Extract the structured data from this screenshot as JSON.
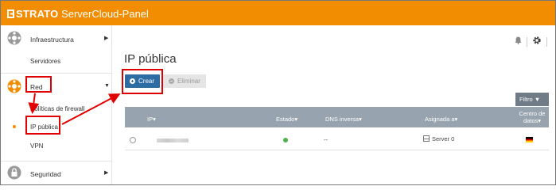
{
  "header": {
    "brand": "STRATO",
    "product": "ServerCloud-Panel"
  },
  "sidebar": {
    "sections": [
      {
        "label": "Infraestructura",
        "icon": "network-icon",
        "items": [
          "Servidores"
        ]
      },
      {
        "label": "Red",
        "icon": "network-red-icon",
        "items": [
          "Políticas de firewall",
          "IP pública",
          "VPN"
        ],
        "active_item": "IP pública"
      },
      {
        "label": "Seguridad",
        "icon": "lock-icon",
        "items": []
      }
    ]
  },
  "main": {
    "title": "IP pública",
    "buttons": {
      "create": "Crear",
      "delete": "Eliminar",
      "filter": "Filtro"
    },
    "table": {
      "columns": [
        "IP",
        "Estado",
        "DNS inversa",
        "Asignada a",
        "Centro de datos"
      ],
      "rows": [
        {
          "ip": "",
          "estado": "active",
          "dns": "--",
          "asignada": "Server 0",
          "centro": "de-flag"
        }
      ]
    }
  },
  "colors": {
    "accent": "#f28c00",
    "primary_button": "#2e6da4",
    "annotation": "#e00000"
  }
}
